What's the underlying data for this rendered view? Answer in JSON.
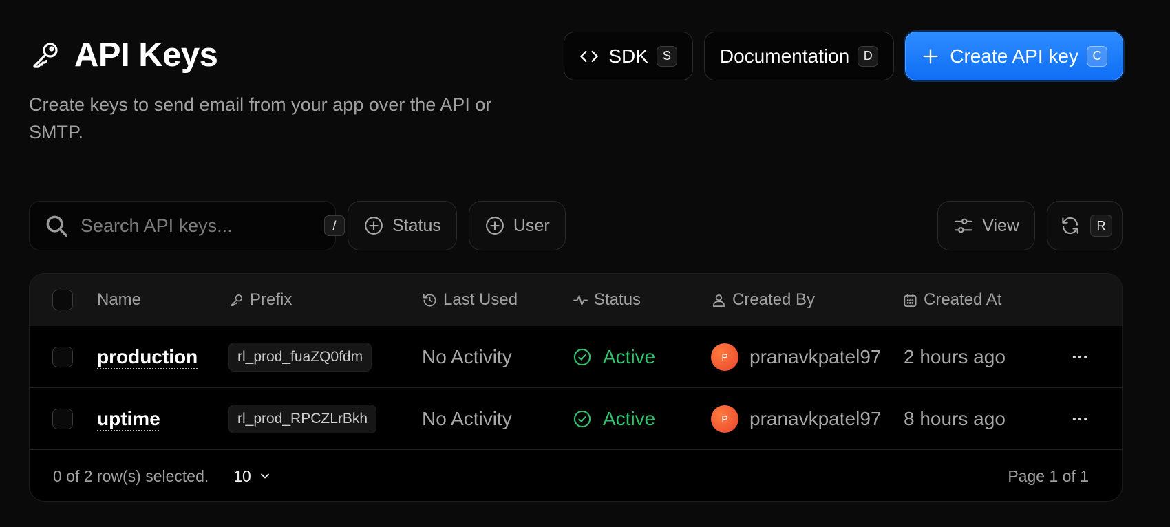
{
  "header": {
    "title": "API Keys",
    "title_icon": "key-icon",
    "subtitle": "Create keys to send email from your app over the API or SMTP."
  },
  "actions": {
    "sdk": {
      "label": "SDK",
      "shortcut": "S",
      "icon": "code-icon"
    },
    "docs": {
      "label": "Documentation",
      "shortcut": "D"
    },
    "create": {
      "label": "Create API key",
      "shortcut": "C",
      "icon": "plus-icon",
      "color": "#1a7cff"
    }
  },
  "toolbar": {
    "search_placeholder": "Search API keys...",
    "search_shortcut": "/",
    "status_filter": "Status",
    "user_filter": "User",
    "view_label": "View",
    "refresh_shortcut": "R"
  },
  "table": {
    "columns": {
      "name": "Name",
      "prefix": "Prefix",
      "last_used": "Last Used",
      "status": "Status",
      "created_by": "Created By",
      "created_at": "Created At"
    },
    "rows": [
      {
        "name": "production",
        "prefix": "rl_prod_fuaZQ0fdm",
        "last_used": "No Activity",
        "status": "Active",
        "avatar_initial": "P",
        "created_by": "pranavkpatel97",
        "created_at": "2 hours ago"
      },
      {
        "name": "uptime",
        "prefix": "rl_prod_RPCZLrBkh",
        "last_used": "No Activity",
        "status": "Active",
        "avatar_initial": "P",
        "created_by": "pranavkpatel97",
        "created_at": "8 hours ago"
      }
    ],
    "footer": {
      "selection": "0 of 2 row(s) selected.",
      "page_size": "10",
      "pagination": "Page 1 of 1"
    }
  },
  "colors": {
    "background": "#0a0a0a",
    "accent": "#1a7cff",
    "active_status": "#32c26e"
  }
}
